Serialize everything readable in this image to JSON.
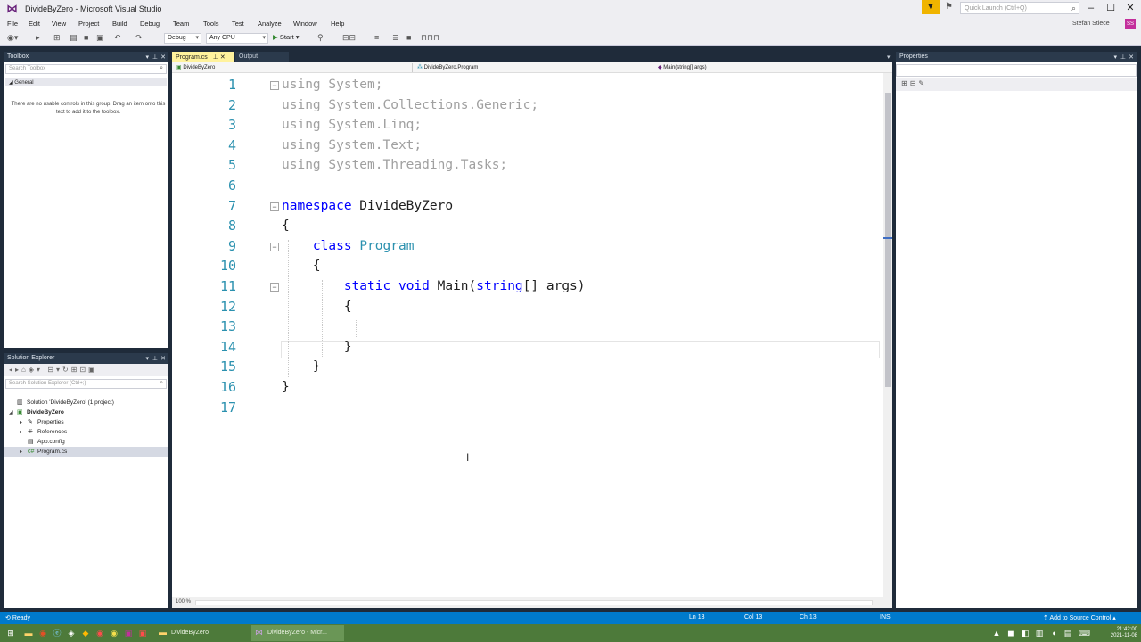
{
  "window": {
    "title": "DivideByZero - Microsoft Visual Studio",
    "quick_launch_placeholder": "Quick Launch (Ctrl+Q)",
    "user_name": "Stefan Stiece",
    "avatar_initials": "SS"
  },
  "menu": [
    "File",
    "Edit",
    "View",
    "Project",
    "Build",
    "Debug",
    "Team",
    "Tools",
    "Test",
    "Analyze",
    "Window",
    "Help"
  ],
  "toolbar": {
    "config": "Debug",
    "platform": "Any CPU",
    "start_label": "Start"
  },
  "toolbox": {
    "title": "Toolbox",
    "search_placeholder": "Search Toolbox",
    "group": "General",
    "empty_message": "There are no usable controls in this group. Drag an item onto this text to add it to the toolbox."
  },
  "solution_explorer": {
    "title": "Solution Explorer",
    "search_placeholder": "Search Solution Explorer (Ctrl+;)",
    "items": [
      {
        "label": "Solution 'DivideByZero' (1 project)",
        "icon": "solution-icon"
      },
      {
        "label": "DivideByZero",
        "icon": "csharp-project-icon"
      },
      {
        "label": "Properties",
        "icon": "wrench-icon"
      },
      {
        "label": "References",
        "icon": "references-icon"
      },
      {
        "label": "App.config",
        "icon": "config-file-icon"
      },
      {
        "label": "Program.cs",
        "icon": "csharp-file-icon"
      }
    ]
  },
  "editor": {
    "tabs": [
      {
        "label": "Program.cs",
        "active": true
      },
      {
        "label": "Output",
        "active": false
      }
    ],
    "nav": {
      "project": "DivideByZero",
      "type": "DivideByZero.Program",
      "member": "Main(string[] args)"
    },
    "zoom": "100 %",
    "lines": [
      "using System;",
      "using System.Collections.Generic;",
      "using System.Linq;",
      "using System.Text;",
      "using System.Threading.Tasks;",
      "",
      "namespace DivideByZero",
      "{",
      "    class Program",
      "    {",
      "        static void Main(string[] args)",
      "        {",
      "",
      "        }",
      "    }",
      "}",
      ""
    ]
  },
  "properties": {
    "title": "Properties"
  },
  "status": {
    "ready": "Ready",
    "ln": "Ln 13",
    "col": "Col 13",
    "ch": "Ch 13",
    "mode": "INS",
    "source_control": "Add to Source Control"
  },
  "taskbar": {
    "tasks": [
      {
        "label": "DivideByZero",
        "icon": "folder-icon",
        "active": false
      },
      {
        "label": "DivideByZero - Micr...",
        "icon": "visual-studio-icon",
        "active": true
      }
    ],
    "time": "21:42:00",
    "date": "2021-11-08"
  },
  "colors": {
    "keyword": "#0000ff",
    "type": "#2b91af",
    "line_number": "#2b91af",
    "status_bar": "#007acc",
    "active_tab": "#fff29d",
    "frame": "#1f2b3a"
  }
}
